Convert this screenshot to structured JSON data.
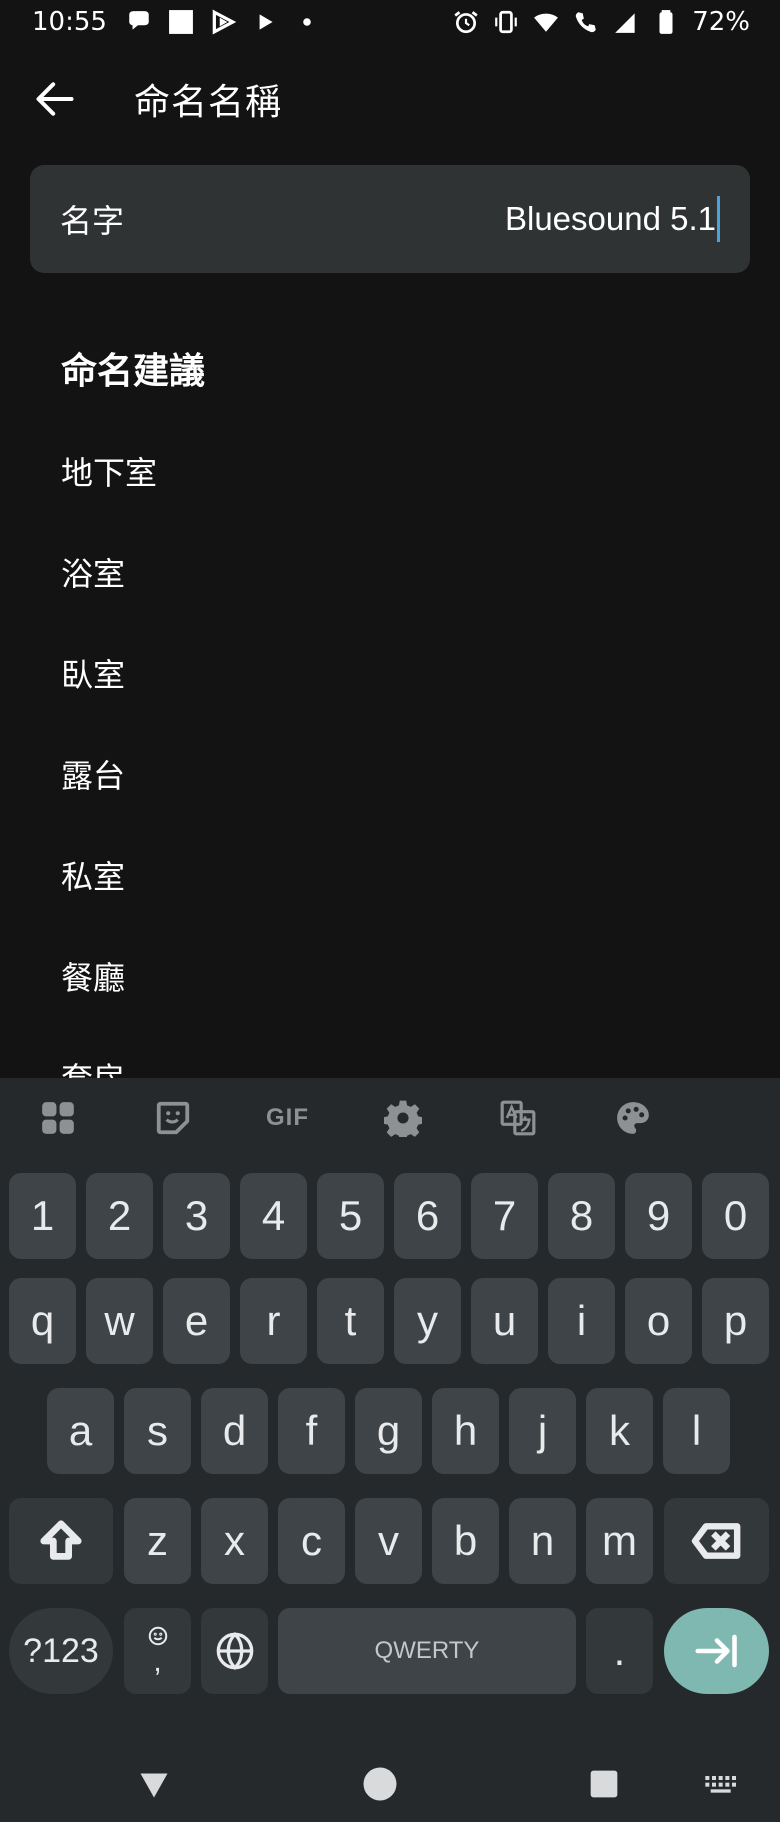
{
  "status_bar": {
    "time": "10:55",
    "battery": "72%",
    "left_icons": [
      "chat-bubble-icon",
      "white-square-icon",
      "play-badge-icon",
      "play-icon",
      "dot-icon"
    ],
    "right_icons": [
      "alarm-icon",
      "vibrate-icon",
      "wifi-icon",
      "wifi-call-icon",
      "signal-icon",
      "battery-icon"
    ]
  },
  "app_bar": {
    "title": "命名名稱"
  },
  "name_field": {
    "label": "名字",
    "value": "Bluesound 5.1"
  },
  "suggestions": {
    "title": "命名建議",
    "items": [
      "地下室",
      "浴室",
      "臥室",
      "露台",
      "私室",
      "餐廳",
      "套房"
    ]
  },
  "keyboard": {
    "toolbar_gif": "GIF",
    "toolbar_icons": [
      "apps-grid-icon",
      "sticker-icon",
      "gif-icon",
      "settings-icon",
      "translate-icon",
      "palette-icon"
    ],
    "row_numbers": [
      "1",
      "2",
      "3",
      "4",
      "5",
      "6",
      "7",
      "8",
      "9",
      "0"
    ],
    "row_1": [
      "q",
      "w",
      "e",
      "r",
      "t",
      "y",
      "u",
      "i",
      "o",
      "p"
    ],
    "row_2": [
      "a",
      "s",
      "d",
      "f",
      "g",
      "h",
      "j",
      "k",
      "l"
    ],
    "row_3": [
      "z",
      "x",
      "c",
      "v",
      "b",
      "n",
      "m"
    ],
    "symbols_label": "?123",
    "emoji_comma": ",",
    "space_label": "QWERTY",
    "period_label": "."
  },
  "colors": {
    "background": "#131313",
    "field_bg": "#2f3333",
    "keyboard_bg": "#26292b",
    "key_bg": "#3e4447",
    "enter_key": "#7fb8b1",
    "caret": "#4aa3df"
  }
}
